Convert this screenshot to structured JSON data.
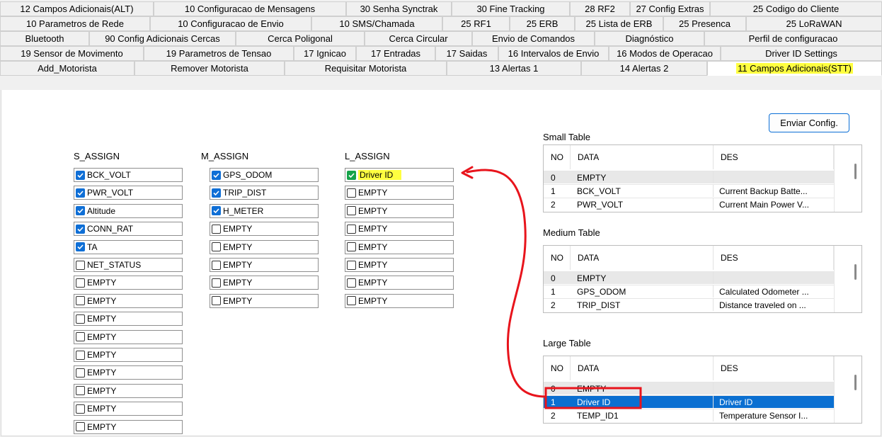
{
  "tabs": {
    "row1": [
      "12 Campos Adicionais(ALT)",
      "10 Configuracao de Mensagens",
      "30 Senha Synctrak",
      "30 Fine Tracking",
      "28 RF2",
      "27 Config Extras",
      "25 Codigo do Cliente"
    ],
    "row2": [
      "10 Parametros de Rede",
      "10 Configuracao de Envio",
      "10 SMS/Chamada",
      "25 RF1",
      "25 ERB",
      "25 Lista de ERB",
      "25 Presenca",
      "25 LoRaWAN"
    ],
    "row3": [
      "Bluetooth",
      "90 Config Adicionais Cercas",
      "Cerca Poligonal",
      "Cerca Circular",
      "Envio de Comandos",
      "Diagnóstico",
      "Perfil de configuracao"
    ],
    "row4": [
      "19 Sensor de Movimento",
      "19 Parametros de Tensao",
      "17 Ignicao",
      "17 Entradas",
      "17 Saidas",
      "16 Intervalos de Envio",
      "16 Modos de Operacao",
      "Driver ID Settings"
    ],
    "row5": [
      "Add_Motorista",
      "Remover Motorista",
      "Requisitar Motorista",
      "13 Alertas 1",
      "14 Alertas 2",
      "11 Campos Adicionais(STT)"
    ]
  },
  "assign": {
    "s_title": "S_ASSIGN",
    "m_title": "M_ASSIGN",
    "l_title": "L_ASSIGN",
    "s_items": [
      {
        "label": "BCK_VOLT",
        "checked": true
      },
      {
        "label": "PWR_VOLT",
        "checked": true
      },
      {
        "label": "Altitude",
        "checked": true
      },
      {
        "label": "CONN_RAT",
        "checked": true
      },
      {
        "label": "TA",
        "checked": true
      },
      {
        "label": "NET_STATUS",
        "checked": false
      },
      {
        "label": "EMPTY",
        "checked": false
      },
      {
        "label": "EMPTY",
        "checked": false
      },
      {
        "label": "EMPTY",
        "checked": false
      },
      {
        "label": "EMPTY",
        "checked": false
      },
      {
        "label": "EMPTY",
        "checked": false
      },
      {
        "label": "EMPTY",
        "checked": false
      },
      {
        "label": "EMPTY",
        "checked": false
      },
      {
        "label": "EMPTY",
        "checked": false
      },
      {
        "label": "EMPTY",
        "checked": false
      }
    ],
    "m_items": [
      {
        "label": "GPS_ODOM",
        "checked": true
      },
      {
        "label": "TRIP_DIST",
        "checked": true
      },
      {
        "label": "H_METER",
        "checked": true
      },
      {
        "label": "EMPTY",
        "checked": false
      },
      {
        "label": "EMPTY",
        "checked": false
      },
      {
        "label": "EMPTY",
        "checked": false
      },
      {
        "label": "EMPTY",
        "checked": false
      },
      {
        "label": "EMPTY",
        "checked": false
      }
    ],
    "l_items": [
      {
        "label": "Driver ID",
        "checked": true
      },
      {
        "label": "EMPTY",
        "checked": false
      },
      {
        "label": "EMPTY",
        "checked": false
      },
      {
        "label": "EMPTY",
        "checked": false
      },
      {
        "label": "EMPTY",
        "checked": false
      },
      {
        "label": "EMPTY",
        "checked": false
      },
      {
        "label": "EMPTY",
        "checked": false
      },
      {
        "label": "EMPTY",
        "checked": false
      }
    ]
  },
  "send_button": "Enviar Config.",
  "tables": {
    "headers": [
      "NO",
      "DATA",
      "DES"
    ],
    "small": {
      "title": "Small Table",
      "rows": [
        [
          "0",
          "EMPTY",
          ""
        ],
        [
          "1",
          "BCK_VOLT",
          "Current Backup Batte..."
        ],
        [
          "2",
          "PWR_VOLT",
          "Current Main Power V..."
        ]
      ]
    },
    "medium": {
      "title": "Medium Table",
      "rows": [
        [
          "0",
          "EMPTY",
          ""
        ],
        [
          "1",
          "GPS_ODOM",
          "Calculated Odometer ..."
        ],
        [
          "2",
          "TRIP_DIST",
          "Distance traveled on ..."
        ]
      ]
    },
    "large": {
      "title": "Large Table",
      "rows": [
        [
          "0",
          "EMPTY",
          ""
        ],
        [
          "1",
          "Driver ID",
          "Driver ID"
        ],
        [
          "2",
          "TEMP_ID1",
          "Temperature Sensor I..."
        ]
      ]
    }
  },
  "colors": {
    "highlight": "#ffff40",
    "selection": "#0a6fd1",
    "check": "#0f6fd6",
    "annotation": "#e8141c"
  }
}
